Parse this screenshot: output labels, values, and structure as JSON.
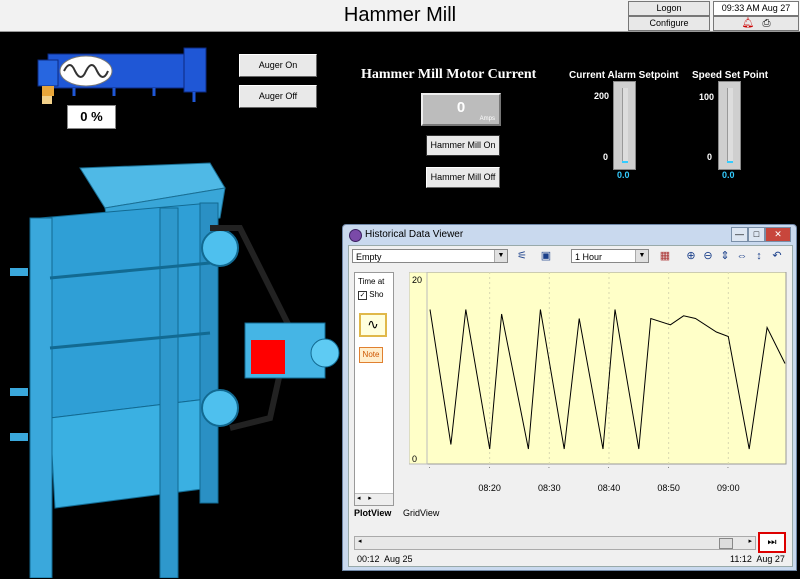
{
  "header": {
    "title": "Hammer Mill",
    "logon_label": "Logon",
    "configure_label": "Configure",
    "clock": "09:33 AM Aug 27",
    "alarm_icon": "bell-icon",
    "print_icon": "printer-icon"
  },
  "auger": {
    "percent": "0 %",
    "on_label": "Auger On",
    "off_label": "Auger Off"
  },
  "motor": {
    "title": "Hammer Mill Motor Current",
    "value": "0",
    "unit": "Amps",
    "on_label": "Hammer Mill On",
    "off_label": "Hammer Mill Off"
  },
  "alarm_setpoint": {
    "title": "Current Alarm Setpoint",
    "max": "200",
    "min": "0",
    "value": "0.0",
    "level": 0.0
  },
  "speed_setpoint": {
    "title": "Speed Set Point",
    "max": "100",
    "min": "0",
    "value": "0.0",
    "level": 0.0
  },
  "viewer": {
    "title": "Historical Data Viewer",
    "minimize_label": "—",
    "maximize_label": "□",
    "close_label": "✕",
    "tagset": "Empty",
    "duration": "1 Hour",
    "left_panel": {
      "time_label": "Time at",
      "show_label": "Sho",
      "note_label": "Note"
    },
    "tabs": [
      "PlotView",
      "GridView"
    ],
    "range_start": "00:12  Aug 25",
    "range_end": "11:12  Aug 27",
    "end_button": "⏭"
  },
  "chart_data": {
    "type": "line",
    "title": "",
    "xlabel": "",
    "ylabel": "",
    "ylim": [
      0,
      20
    ],
    "y_ticks": [
      "20",
      "0"
    ],
    "x_ticks": [
      "08:20",
      "08:30",
      "08:40",
      "08:50",
      "09:00"
    ],
    "x_tick_minutes": [
      20,
      30,
      40,
      50,
      60
    ],
    "xlim_minutes": [
      9.5,
      69.5
    ],
    "series": [
      {
        "points": [
          [
            10,
            16.5
          ],
          [
            13.5,
            1.5
          ],
          [
            16,
            16.5
          ],
          [
            20,
            1
          ],
          [
            22,
            16
          ],
          [
            26.5,
            1
          ],
          [
            28.5,
            16.5
          ],
          [
            32.5,
            1
          ],
          [
            35,
            15.5
          ],
          [
            39,
            1
          ],
          [
            41,
            16.5
          ],
          [
            45,
            1
          ],
          [
            47,
            15.5
          ],
          [
            50.3,
            14.8
          ],
          [
            52.5,
            15.8
          ],
          [
            54.5,
            15.5
          ],
          [
            58,
            14
          ],
          [
            60,
            13.5
          ],
          [
            63.5,
            1
          ],
          [
            66.5,
            14.5
          ],
          [
            69.5,
            10.5
          ]
        ]
      }
    ]
  }
}
